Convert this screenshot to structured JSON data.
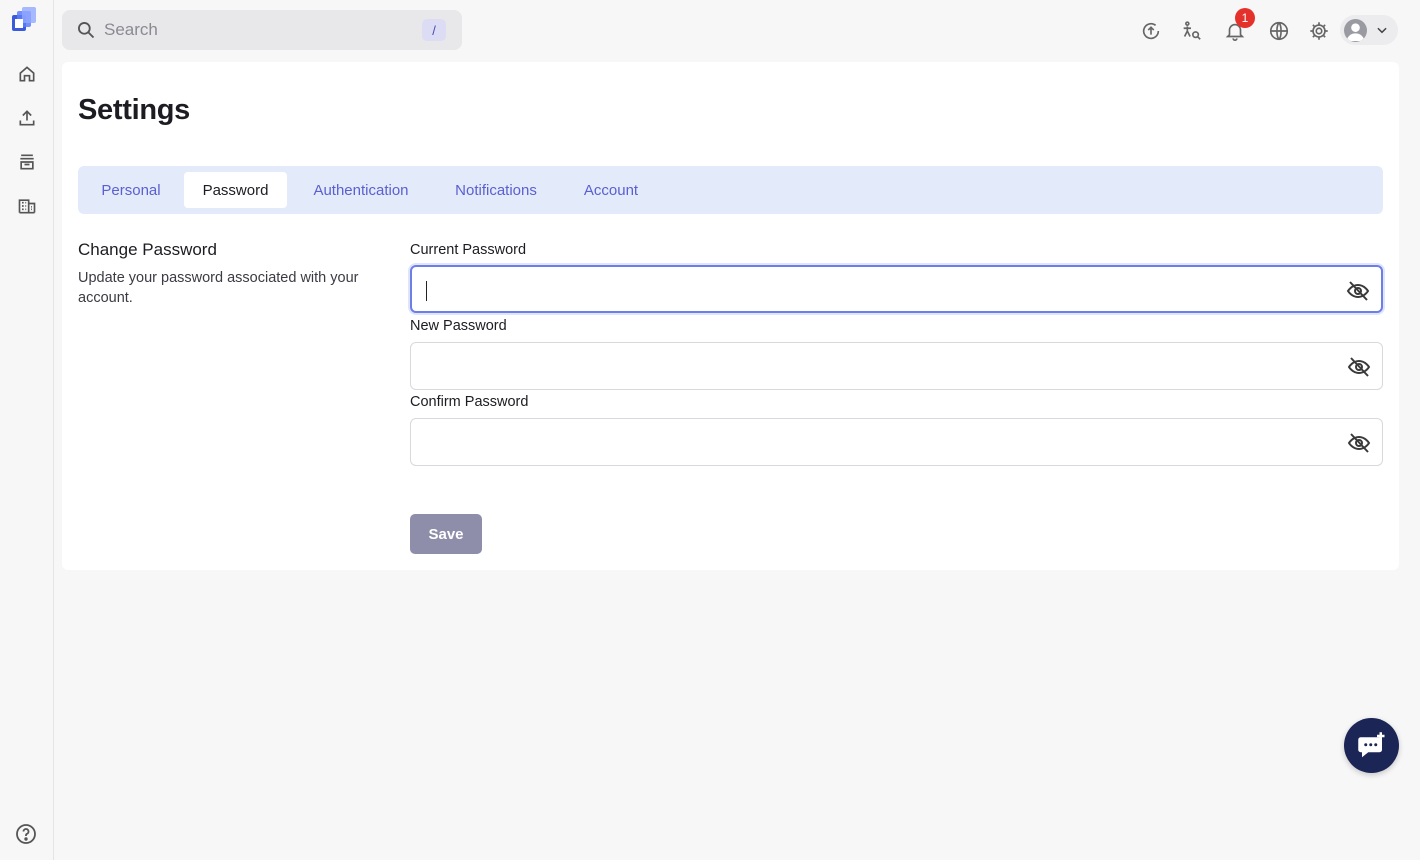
{
  "icons": {
    "logo": "app-logo",
    "home": "home-icon",
    "upload": "upload-icon",
    "archive": "archive-icon",
    "building": "building-icon",
    "help": "help-icon",
    "search": "search-icon",
    "upload_circle": "upload-circle-icon",
    "translate": "translate-icon",
    "bell": "bell-icon",
    "globe": "globe-icon",
    "gear": "gear-icon",
    "chat": "chat-icon",
    "eye_off": "eye-off-icon"
  },
  "search": {
    "placeholder": "Search",
    "shortcut": "/"
  },
  "header": {
    "notification_count": "1"
  },
  "page": {
    "title": "Settings"
  },
  "tabs": [
    {
      "label": "Personal"
    },
    {
      "label": "Password"
    },
    {
      "label": "Authentication"
    },
    {
      "label": "Notifications"
    },
    {
      "label": "Account"
    }
  ],
  "active_tab": "Password",
  "section": {
    "title": "Change Password",
    "description": "Update your password associated with your account."
  },
  "fields": [
    {
      "label": "Current Password",
      "value": ""
    },
    {
      "label": "New Password",
      "value": ""
    },
    {
      "label": "Confirm Password",
      "value": ""
    }
  ],
  "save_label": "Save",
  "colors": {
    "accent": "#5b5fcf",
    "tab_bar": "#e3ebfb",
    "badge": "#e5312b",
    "save_button": "#8e8eaa",
    "chat_button": "#1b2656"
  }
}
